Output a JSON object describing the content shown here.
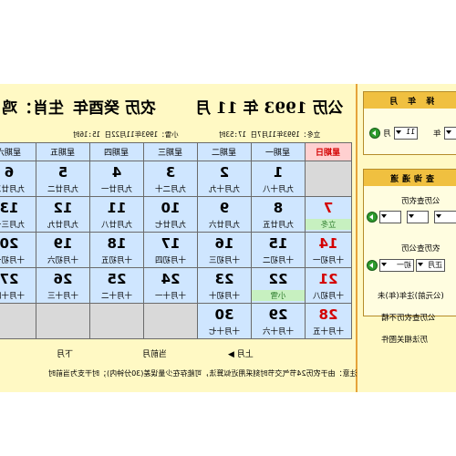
{
  "title": {
    "gregorian": "公历 1993 年 11 月",
    "lunar": "农历 癸酉年",
    "zodiac": "生肖：鸡"
  },
  "info": {
    "lichun": "立冬：1993年11月7日 17:53时",
    "xiaoxue": "小雪：1993年11月22日 15:16时"
  },
  "weekdays": [
    "星期日",
    "星期一",
    "星期二",
    "星期三",
    "星期四",
    "星期五",
    "星期六"
  ],
  "weeks": [
    [
      {
        "d": "",
        "l": ""
      },
      {
        "d": "1",
        "l": "九月十八"
      },
      {
        "d": "2",
        "l": "九月十九"
      },
      {
        "d": "3",
        "l": "九月二十"
      },
      {
        "d": "4",
        "l": "九月廿一"
      },
      {
        "d": "5",
        "l": "九月廿二"
      },
      {
        "d": "6",
        "l": "九月廿三"
      }
    ],
    [
      {
        "d": "7",
        "l": "立冬"
      },
      {
        "d": "8",
        "l": "九月廿五"
      },
      {
        "d": "9",
        "l": "九月廿六"
      },
      {
        "d": "10",
        "l": "九月廿七"
      },
      {
        "d": "11",
        "l": "九月廿八"
      },
      {
        "d": "12",
        "l": "九月廿九"
      },
      {
        "d": "13",
        "l": "九月三十"
      }
    ],
    [
      {
        "d": "14",
        "l": "十月初一"
      },
      {
        "d": "15",
        "l": "十月初二"
      },
      {
        "d": "16",
        "l": "十月初三"
      },
      {
        "d": "17",
        "l": "十月初四"
      },
      {
        "d": "18",
        "l": "十月初五"
      },
      {
        "d": "19",
        "l": "十月初六"
      },
      {
        "d": "20",
        "l": "十月初七"
      }
    ],
    [
      {
        "d": "21",
        "l": "十月初八"
      },
      {
        "d": "22",
        "l": "小雪"
      },
      {
        "d": "23",
        "l": "十月初十"
      },
      {
        "d": "24",
        "l": "十月十一"
      },
      {
        "d": "25",
        "l": "十月十二"
      },
      {
        "d": "26",
        "l": "十月十三"
      },
      {
        "d": "27",
        "l": "十月十四"
      }
    ],
    [
      {
        "d": "28",
        "l": "十月十五"
      },
      {
        "d": "29",
        "l": "十月十六"
      },
      {
        "d": "30",
        "l": "十月十七"
      },
      {
        "d": "",
        "l": ""
      },
      {
        "d": "",
        "l": ""
      },
      {
        "d": "",
        "l": ""
      },
      {
        "d": "",
        "l": ""
      }
    ]
  ],
  "nav": {
    "prev_month": "上月 ▶",
    "this_month": "当前月",
    "next_month": "下月",
    "prev_arrow": "◀ 下月"
  },
  "note": "注意：由于农历24节气交节时刻采用近似算法，可能存在少量误差(30分钟内)；时干支为当前时",
  "side": {
    "select_month_head": "择 年 月",
    "year_label": "年",
    "month_label": "月",
    "month_value": "11",
    "query_head": "查询通道",
    "from_gregorian": "公历查农历",
    "from_lunar": "农历查公历",
    "lunar_month_value": "正月",
    "lunar_day_value": "初一",
    "note1": "(公元前)注年(年)未",
    "note2": "公历查农历不精",
    "note3": "历法相关图件"
  },
  "colors": {
    "panel_bg": "#fff9c4",
    "cell_bg": "#cfe6ff",
    "accent_border": "#e5a33a",
    "sunday_red": "#d40000",
    "go_green": "#2d9b2d"
  }
}
